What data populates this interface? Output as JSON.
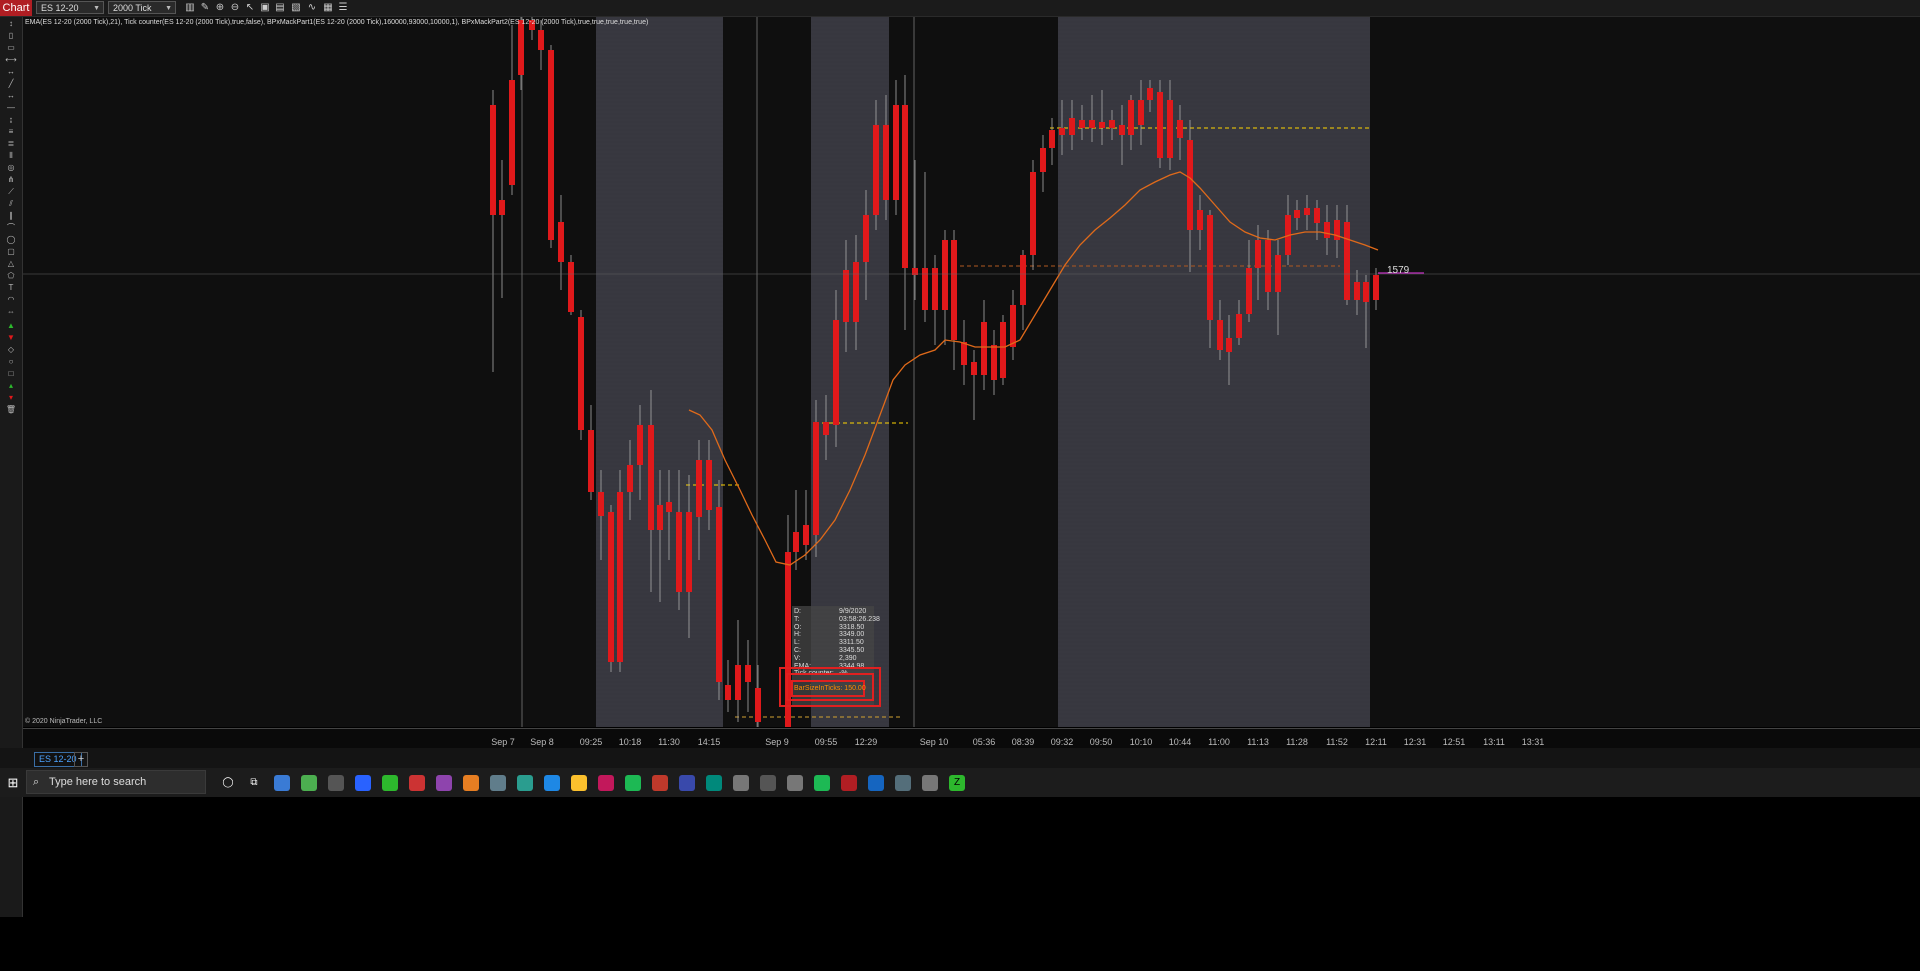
{
  "app": {
    "tab_label": "Chart",
    "brand_color": "#b01e23"
  },
  "toolbar": {
    "instrument": "ES 12-20",
    "period": "2000 Tick",
    "icons": [
      "bars-type-icon",
      "pencil-icon",
      "zoom-in-icon",
      "zoom-out-icon",
      "pointer-icon",
      "snapshot-icon",
      "properties-icon",
      "strategies-icon",
      "indicators-icon",
      "templates-icon",
      "data-box-icon"
    ]
  },
  "chart_header": {
    "indicators": "EMA(ES 12-20 (2000 Tick),21), Tick counter(ES 12-20 (2000 Tick),true,false), BPxMackPart1(ES 12-20 (2000 Tick),160000,93000,10000,1), BPxMackPart2(ES 12-20 (2000 Tick),true,true,true,true,true)"
  },
  "copyright": "© 2020 NinjaTrader, LLC",
  "price_marker": "1579",
  "x_axis_labels": [
    "Sep 7",
    "Sep 8",
    "09:25",
    "10:18",
    "11:30",
    "14:15",
    "Sep 9",
    "09:55",
    "12:29",
    "Sep 10",
    "05:36",
    "08:39",
    "09:32",
    "09:50",
    "10:10",
    "10:44",
    "11:00",
    "11:13",
    "11:28",
    "11:52",
    "12:11",
    "12:31",
    "12:51",
    "13:11",
    "13:31"
  ],
  "data_box": {
    "rows": [
      {
        "k": "D:",
        "v": "9/9/2020"
      },
      {
        "k": "T:",
        "v": "03:58:26.238"
      },
      {
        "k": "O:",
        "v": "3318.50"
      },
      {
        "k": "H:",
        "v": "3349.00"
      },
      {
        "k": "L:",
        "v": "3311.50"
      },
      {
        "k": "C:",
        "v": "3345.50"
      },
      {
        "k": "V:",
        "v": "2,390"
      },
      {
        "k": "EMA:",
        "v": "3344.98"
      },
      {
        "k": "Tick counter:",
        "v": "-%"
      }
    ],
    "bar_size": "BarSizeInTicks: 150.00"
  },
  "bottom_tab": {
    "label": "ES 12-20",
    "add": "+"
  },
  "taskbar": {
    "search_placeholder": "Type here to search",
    "icons": [
      "windows-start-icon",
      "cortana-icon",
      "task-view-icon",
      "file-explorer-icon",
      "store-icon",
      "chrome-icon",
      "app-icon",
      "app-icon",
      "app-icon",
      "app-icon",
      "app-icon",
      "app-icon",
      "app-icon",
      "app-icon",
      "steam-icon",
      "app-icon",
      "app-icon",
      "app-icon",
      "app-icon",
      "app-icon",
      "app-icon",
      "app-icon",
      "spotify-icon",
      "ninjatrader-icon",
      "app-icon",
      "app-icon",
      "settings-icon",
      "app-icon",
      "zoom-icon"
    ]
  },
  "colors": {
    "up": "#2db82d",
    "down": "#e0191b",
    "ema": "#e06a1a",
    "dashed_level": "#ffd400",
    "session_shade": "#37373f"
  }
}
